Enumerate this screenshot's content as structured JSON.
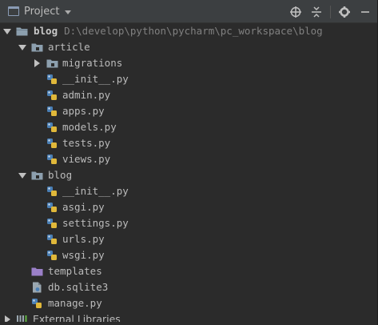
{
  "header": {
    "title": "Project"
  },
  "tree": {
    "root": {
      "name": "blog",
      "path": "D:\\develop\\python\\pycharm\\pc_workspace\\blog"
    },
    "article": {
      "name": "article",
      "migrations": "migrations",
      "files": [
        "__init__.py",
        "admin.py",
        "apps.py",
        "models.py",
        "tests.py",
        "views.py"
      ]
    },
    "blog_pkg": {
      "name": "blog",
      "files": [
        "__init__.py",
        "asgi.py",
        "settings.py",
        "urls.py",
        "wsgi.py"
      ]
    },
    "templates": "templates",
    "db": "db.sqlite3",
    "manage": "manage.py",
    "external": "External Libraries"
  },
  "colors": {
    "background": "#2b2b2b",
    "header": "#3c3f41",
    "folder": "#8c9fae",
    "templates_folder": "#9b80c8",
    "python_blue": "#4a7fb5",
    "python_yellow": "#e0b83a",
    "text": "#bbbbbb",
    "path_text": "#808080"
  }
}
